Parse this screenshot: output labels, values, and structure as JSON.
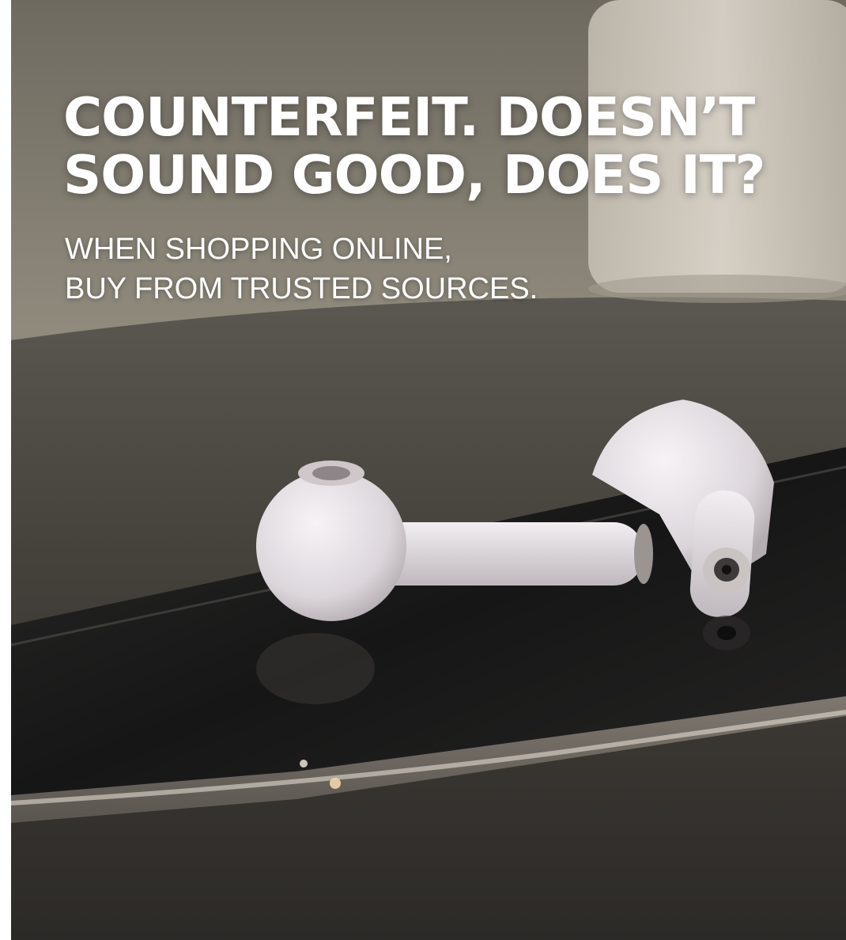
{
  "headline": {
    "line1": "COUNTERFEIT. DOESN’T",
    "line2": "SOUND GOOD, DOES IT?"
  },
  "subline": {
    "line1": "WHEN SHOPPING ONLINE,",
    "line2": "BUY FROM TRUSTED SOURCES."
  },
  "colors": {
    "text": "#ffffff",
    "wall": "#8f8a7c",
    "table": "#3b3833",
    "phone_screen": "#1e1d1c",
    "phone_frame": "#b9b2a8",
    "earbud": "#e4e0e6",
    "cup": "#d8d2c8"
  },
  "icons": [
    "earbud-image",
    "smartphone-image",
    "cup-image"
  ]
}
